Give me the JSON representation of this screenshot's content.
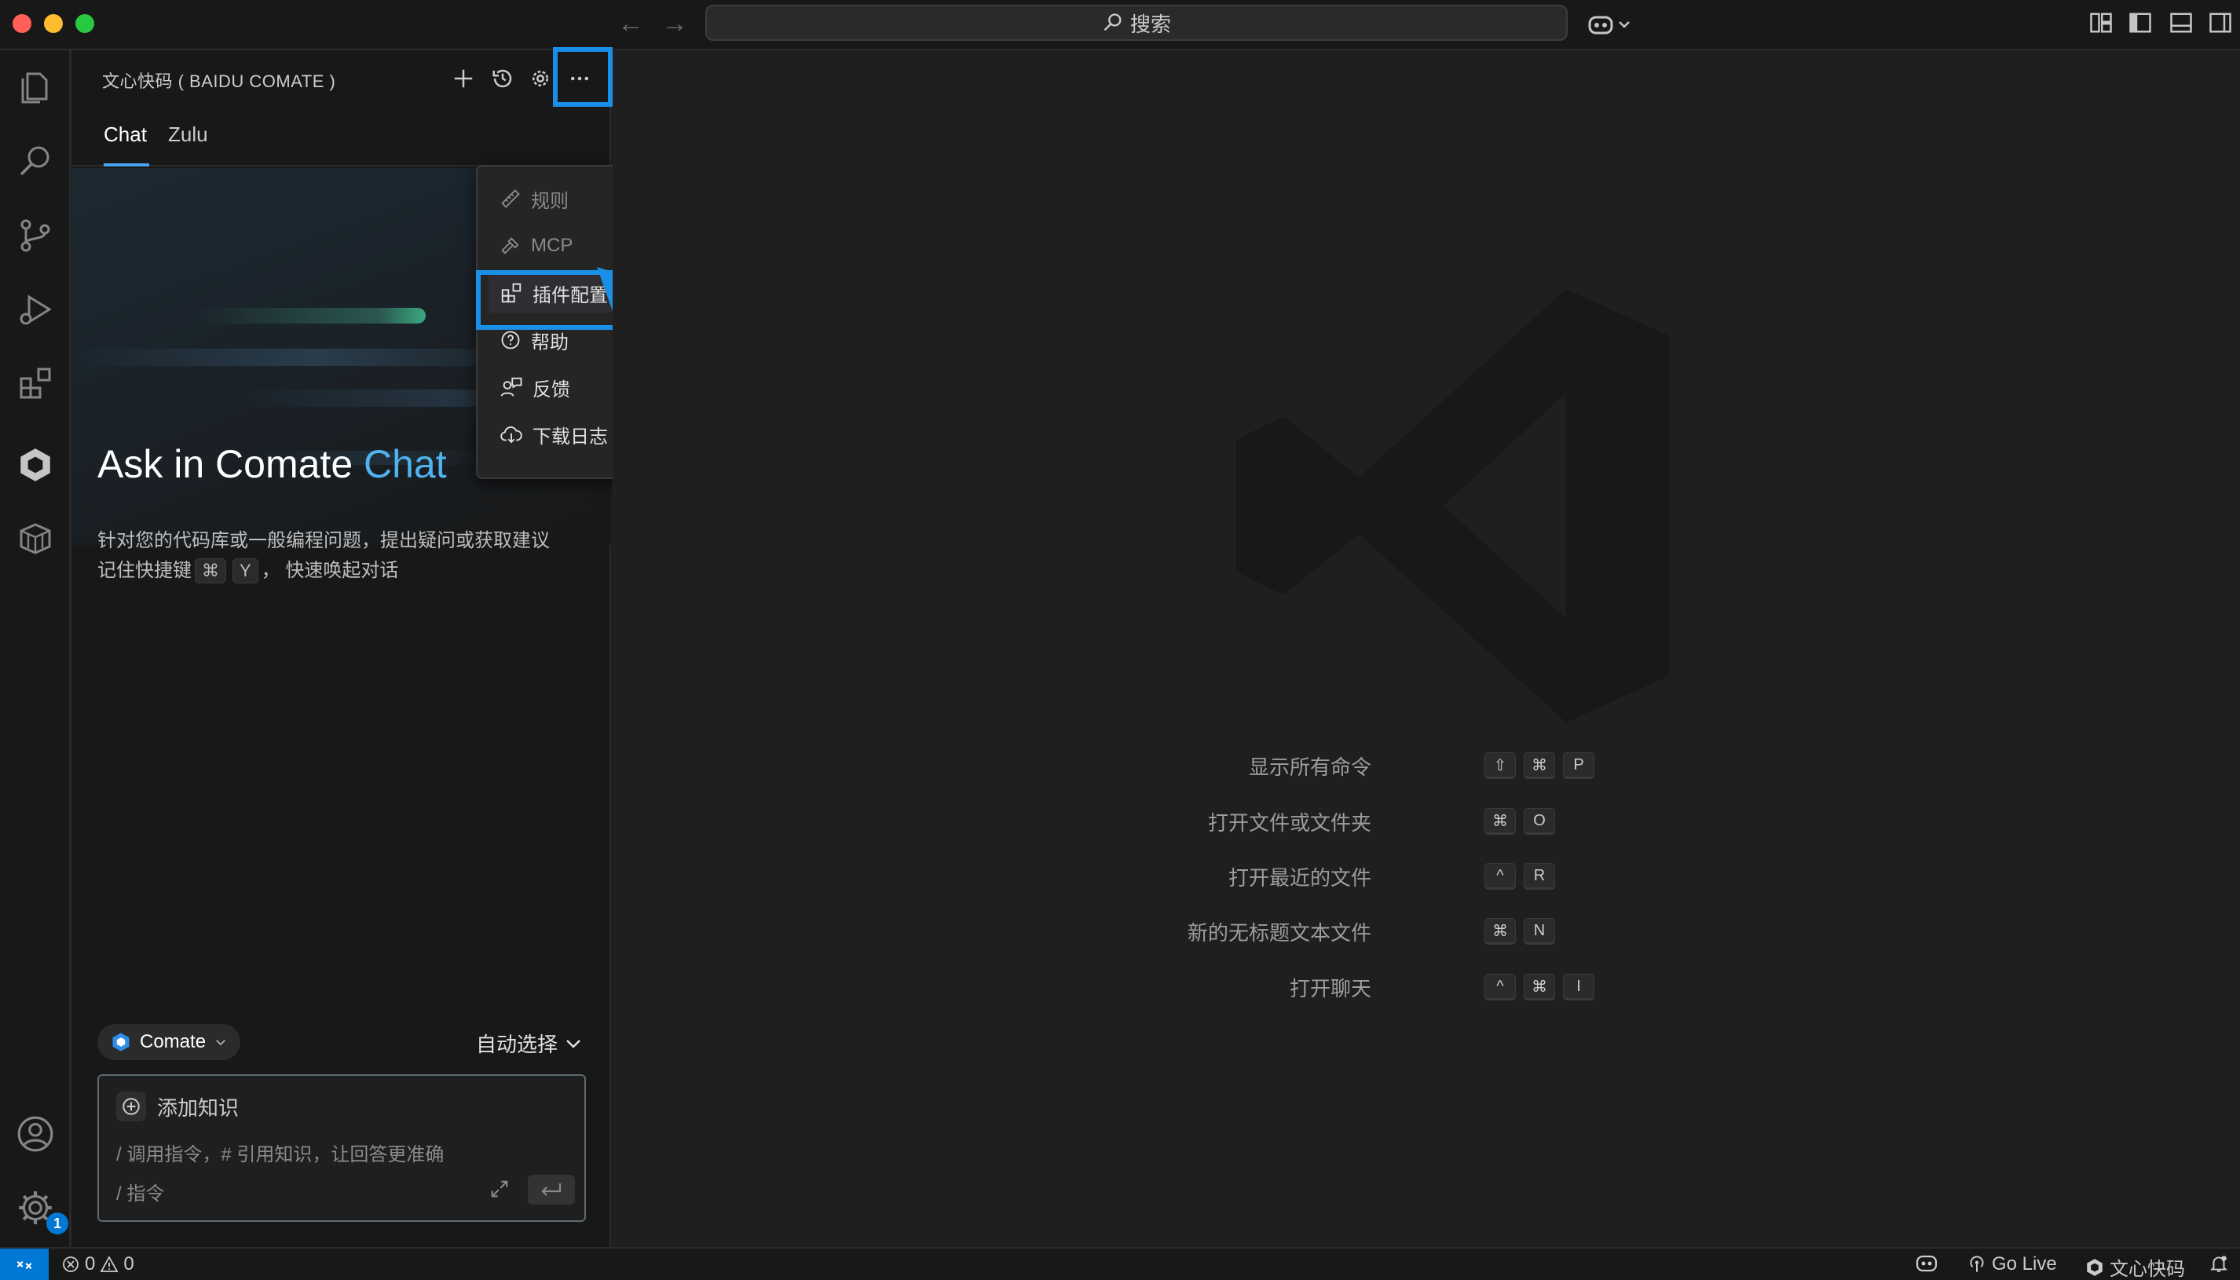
{
  "search": {
    "label": "搜索"
  },
  "panel": {
    "title": "文心快码 ( BAIDU COMATE )",
    "tabs": [
      {
        "label": "Chat"
      },
      {
        "label": "Zulu"
      }
    ],
    "hero_title_prefix": "Ask in Comate ",
    "hero_title_accent": "Chat",
    "desc_line1": "针对您的代码库或一般编程问题，提出疑问或获取建议",
    "desc_line2_prefix": "记住快捷键",
    "desc_key1": "⌘",
    "desc_key2": "Y",
    "desc_line2_suffix": "， 快速唤起对话",
    "model": "Comate",
    "auto_select": "自动选择",
    "add_knowledge": "添加知识",
    "placeholder_line1": "/ 调用指令，# 引用知识，让回答更准确",
    "placeholder_line2": "/ 指令"
  },
  "menu": {
    "items": [
      {
        "label": "规则",
        "icon": "ruler-icon",
        "disabled": true
      },
      {
        "label": "MCP",
        "icon": "hammer-icon",
        "disabled": true
      },
      {
        "label": "插件配置面板",
        "icon": "extensions-icon",
        "disabled": false
      },
      {
        "label": "帮助",
        "icon": "help-icon",
        "disabled": false
      },
      {
        "label": "反馈",
        "icon": "feedback-icon",
        "disabled": false
      },
      {
        "label": "下载日志",
        "icon": "cloud-download-icon",
        "disabled": false
      }
    ]
  },
  "shortcuts": [
    {
      "label": "显示所有命令",
      "keys": [
        "⇧",
        "⌘",
        "P"
      ]
    },
    {
      "label": "打开文件或文件夹",
      "keys": [
        "⌘",
        "O"
      ]
    },
    {
      "label": "打开最近的文件",
      "keys": [
        "^",
        "R"
      ]
    },
    {
      "label": "新的无标题文本文件",
      "keys": [
        "⌘",
        "N"
      ]
    },
    {
      "label": "打开聊天",
      "keys": [
        "^",
        "⌘",
        "I"
      ]
    }
  ],
  "activity": {
    "settings_badge": "1"
  },
  "status": {
    "errors": "0",
    "warnings": "0",
    "go_live": "Go Live",
    "comate": "文心快码"
  },
  "colors": {
    "accent": "#1a8fe8",
    "link": "#4fb3f0"
  }
}
